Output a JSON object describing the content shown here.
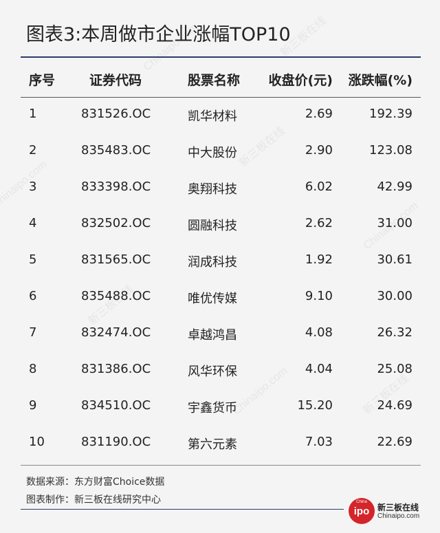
{
  "title": "图表3:本周做市企业涨幅TOP10",
  "headers": {
    "idx": "序号",
    "code": "证券代码",
    "name": "股票名称",
    "price": "收盘价(元)",
    "change": "涨跌幅(%)"
  },
  "rows": [
    {
      "idx": "1",
      "code": "831526.OC",
      "name": "凯华材料",
      "price": "2.69",
      "change": "192.39"
    },
    {
      "idx": "2",
      "code": "835483.OC",
      "name": "中大股份",
      "price": "2.90",
      "change": "123.08"
    },
    {
      "idx": "3",
      "code": "833398.OC",
      "name": "奥翔科技",
      "price": "6.02",
      "change": "42.99"
    },
    {
      "idx": "4",
      "code": "832502.OC",
      "name": "圆融科技",
      "price": "2.62",
      "change": "31.00"
    },
    {
      "idx": "5",
      "code": "831565.OC",
      "name": "润成科技",
      "price": "1.92",
      "change": "30.61"
    },
    {
      "idx": "6",
      "code": "835488.OC",
      "name": "唯优传媒",
      "price": "9.10",
      "change": "30.00"
    },
    {
      "idx": "7",
      "code": "832474.OC",
      "name": "卓越鸿昌",
      "price": "4.08",
      "change": "26.32"
    },
    {
      "idx": "8",
      "code": "831386.OC",
      "name": "风华环保",
      "price": "4.04",
      "change": "25.08"
    },
    {
      "idx": "9",
      "code": "834510.OC",
      "name": "宇鑫货币",
      "price": "15.20",
      "change": "24.69"
    },
    {
      "idx": "10",
      "code": "831190.OC",
      "name": "第六元素",
      "price": "7.03",
      "change": "22.69"
    }
  ],
  "footer": {
    "source": "数据来源：东方财富Choice数据",
    "maker": "图表制作：新三板在线研究中心"
  },
  "logo": {
    "badge_top": "China",
    "badge": "ipo",
    "name_cn": "新三板在线",
    "name_en": "Chinaipo.com"
  },
  "watermark": {
    "text_en": "Chinaipo.com",
    "text_cn": "新三板在线"
  },
  "colors": {
    "accent_rule": "#2a3c68",
    "logo_red": "#d3252a",
    "background": "#f4f4f4"
  }
}
